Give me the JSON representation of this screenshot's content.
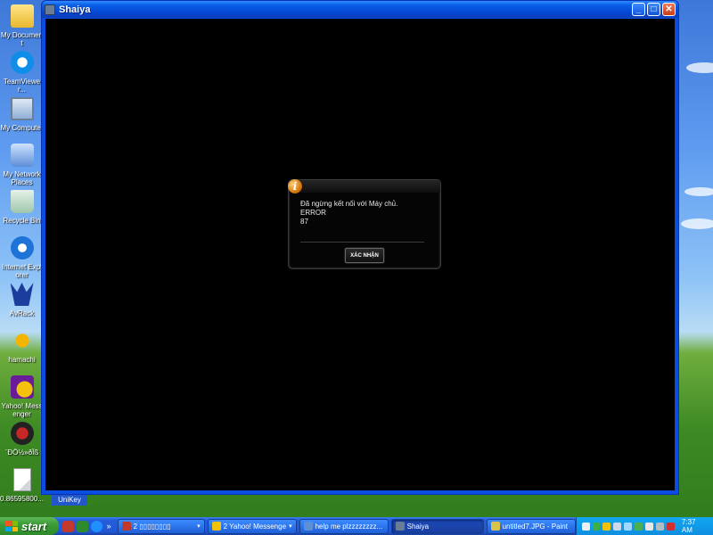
{
  "desktop": {
    "icons": [
      {
        "label": "My Document",
        "icon": "folder-icon"
      },
      {
        "label": "TeamViewer...",
        "icon": "teamviewer-icon"
      },
      {
        "label": "My Computer",
        "icon": "computer-icon"
      },
      {
        "label": "My Network Places",
        "icon": "network-icon"
      },
      {
        "label": "Recycle Bin",
        "icon": "recycle-bin-icon"
      },
      {
        "label": "Internet Explorer",
        "icon": "internet-explorer-icon"
      },
      {
        "label": "AvRack",
        "icon": "avrack-icon"
      },
      {
        "label": "hamachi",
        "icon": "hamachi-icon"
      },
      {
        "label": "Yahoo! Messenger",
        "icon": "yahoo-messenger-icon"
      },
      {
        "label": "¨ÐÖ½»ðÏß",
        "icon": "game-shortcut-icon"
      },
      {
        "label": "0.86595800...",
        "icon": "file-icon"
      }
    ]
  },
  "window": {
    "title": "Shaiya",
    "minimize_symbol": "_",
    "maximize_symbol": "□",
    "close_symbol": "✕"
  },
  "dialog": {
    "icon_glyph": "i",
    "message_lines": [
      "Đã ngừng kết nối với Máy chủ.",
      "ERROR",
      "87"
    ],
    "confirm_label": "XÁC NHẬN"
  },
  "unikey_label": "UniKey",
  "taskbar": {
    "start_label": "start",
    "quick_launch_more": "»",
    "tasks": [
      {
        "label": "2 ▯▯▯▯▯▯▯▯",
        "has_arrow": true,
        "active": false,
        "color": "#c0392b"
      },
      {
        "label": "2 Yahoo! Messenger",
        "has_arrow": true,
        "active": false,
        "color": "#f4c20d"
      },
      {
        "label": "help me plzzzzzzzz...",
        "has_arrow": false,
        "active": false,
        "color": "#5b8fd8"
      },
      {
        "label": "Shaiya",
        "has_arrow": false,
        "active": true,
        "color": "#6a7d96"
      },
      {
        "label": "untitled7.JPG - Paint",
        "has_arrow": false,
        "active": false,
        "color": "#d9c34a"
      }
    ],
    "arrow_symbol": "▾",
    "clock": "7:37 AM"
  },
  "colors": {
    "titlebar": "#0446d2",
    "dialog_bg": "#050505",
    "start_green": "#3c9c37",
    "tray_blue": "#0f8ee0"
  }
}
